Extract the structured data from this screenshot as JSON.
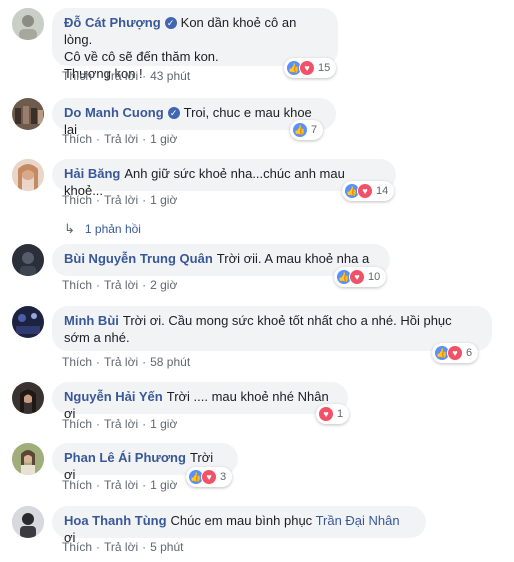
{
  "colors": {
    "name": "#385898",
    "bubble": "#f2f3f5",
    "meta": "#606770",
    "like": "#5890ff",
    "love": "#f25268"
  },
  "comments": [
    {
      "name": "Đỗ Cát Phượng",
      "verified": true,
      "line1": "Kon dần khoẻ cô an lòng.",
      "line2": "Cô về cô sẽ đến thăm kon.",
      "line3": "Thương kon !",
      "like": "Thích",
      "reply": "Trả lời",
      "time": "43 phút",
      "reactions": [
        "like",
        "love"
      ],
      "count": "15"
    },
    {
      "name": "Do Manh Cuong",
      "verified": true,
      "line1": "Troi, chuc e mau khoe lai",
      "like": "Thích",
      "reply": "Trả lời",
      "time": "1 giờ",
      "reactions": [
        "like"
      ],
      "count": "7"
    },
    {
      "name": "Hải Băng",
      "verified": false,
      "line1": "Anh giữ sức khoẻ nha...chúc anh mau khoẻ...",
      "like": "Thích",
      "reply": "Trả lời",
      "time": "1 giờ",
      "reactions": [
        "like",
        "love"
      ],
      "count": "14",
      "replies": "1 phản hồi"
    },
    {
      "name": "Bùi Nguyễn Trung Quân",
      "verified": false,
      "line1": "Trời ơii. A mau khoẻ nha a",
      "like": "Thích",
      "reply": "Trả lời",
      "time": "2 giờ",
      "reactions": [
        "like",
        "love"
      ],
      "count": "10"
    },
    {
      "name": "Minh Bùi",
      "verified": false,
      "line1": "Trời ơi. Cầu mong sức khoẻ tốt nhất cho a nhé. Hồi phục",
      "line2": "sớm a nhé.",
      "like": "Thích",
      "reply": "Trả lời",
      "time": "58 phút",
      "reactions": [
        "like",
        "love"
      ],
      "count": "6"
    },
    {
      "name": "Nguyễn Hải Yến",
      "verified": false,
      "line1": "Trời .... mau khoẻ nhé Nhân ơi",
      "like": "Thích",
      "reply": "Trả lời",
      "time": "1 giờ",
      "reactions": [
        "love"
      ],
      "count": "1"
    },
    {
      "name": "Phan Lê Ái Phương",
      "verified": false,
      "line1": "Trời ơi",
      "like": "Thích",
      "reply": "Trả lời",
      "time": "1 giờ",
      "reactions": [
        "like",
        "love"
      ],
      "count": "3"
    },
    {
      "name": "Hoa Thanh Tùng",
      "verified": false,
      "line1": "Chúc em mau bình phục ",
      "mention": "Trần Đại Nhân",
      "after": " ơi",
      "like": "Thích",
      "reply": "Trả lời",
      "time": "5 phút"
    }
  ]
}
